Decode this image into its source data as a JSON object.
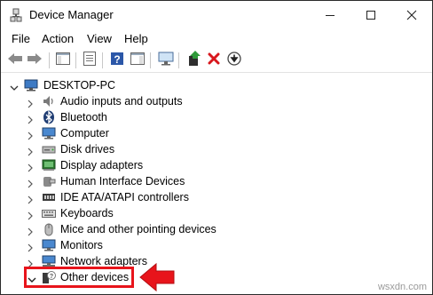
{
  "window": {
    "title": "Device Manager"
  },
  "icons": {
    "app": "device-manager-icon",
    "minimize": "minimize-icon",
    "maximize": "maximize-icon",
    "close": "close-icon"
  },
  "menu": {
    "items": [
      "File",
      "Action",
      "View",
      "Help"
    ]
  },
  "toolbar": {
    "buttons": [
      "back-arrow-icon",
      "forward-arrow-icon",
      "show-hide-console-tree-icon",
      "properties-icon",
      "help-icon",
      "action-pane-icon",
      "scan-hardware-icon",
      "update-driver-icon",
      "uninstall-device-icon",
      "download-arrow-icon"
    ]
  },
  "tree": {
    "root": {
      "label": "DESKTOP-PC",
      "icon": "computer-icon"
    },
    "items": [
      {
        "label": "Audio inputs and outputs",
        "icon": "speaker-icon"
      },
      {
        "label": "Bluetooth",
        "icon": "bluetooth-icon"
      },
      {
        "label": "Computer",
        "icon": "monitor-icon"
      },
      {
        "label": "Disk drives",
        "icon": "disk-drive-icon"
      },
      {
        "label": "Display adapters",
        "icon": "display-adapter-icon"
      },
      {
        "label": "Human Interface Devices",
        "icon": "hid-icon"
      },
      {
        "label": "IDE ATA/ATAPI controllers",
        "icon": "ide-controller-icon"
      },
      {
        "label": "Keyboards",
        "icon": "keyboard-icon"
      },
      {
        "label": "Mice and other pointing devices",
        "icon": "mouse-icon"
      },
      {
        "label": "Monitors",
        "icon": "monitor-icon"
      },
      {
        "label": "Network adapters",
        "icon": "network-adapter-icon"
      },
      {
        "label": "Other devices",
        "icon": "unknown-device-icon"
      }
    ]
  },
  "colors": {
    "highlight": "#e8141b",
    "accent": "#1f5fa8"
  },
  "watermark": "wsxdn.com"
}
